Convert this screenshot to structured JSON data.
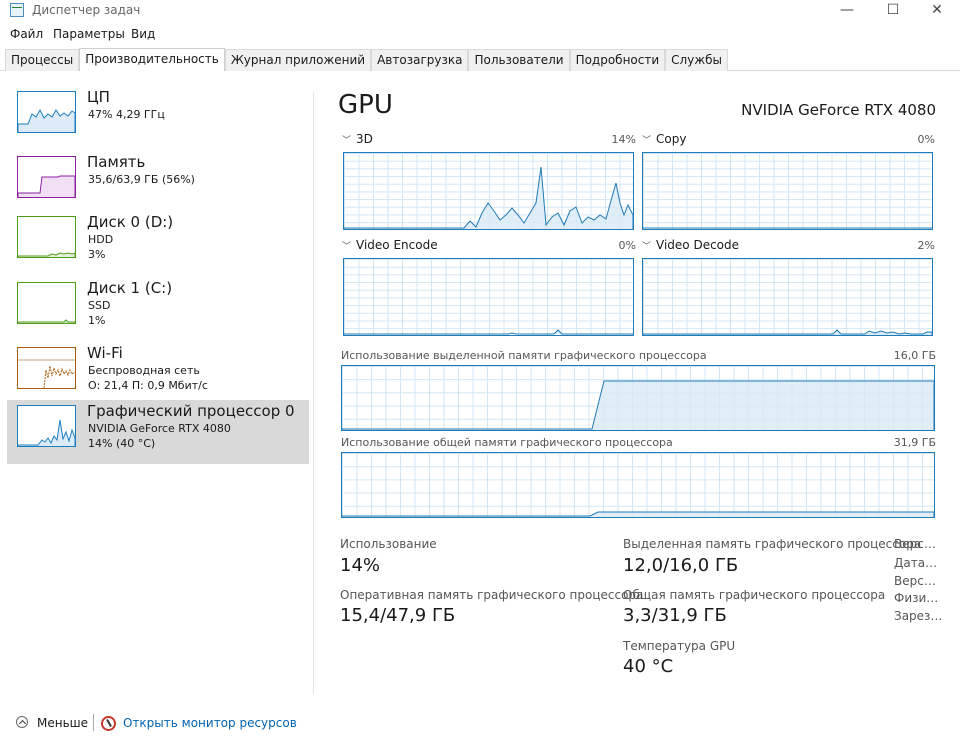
{
  "window": {
    "title": "Диспетчер задач",
    "controls": {
      "minimize": "—",
      "maximize": "☐",
      "close": "✕"
    }
  },
  "menu": [
    "Файл",
    "Параметры",
    "Вид"
  ],
  "tabs": [
    "Процессы",
    "Производительность",
    "Журнал приложений",
    "Автозагрузка",
    "Пользователи",
    "Подробности",
    "Службы"
  ],
  "active_tab": "Производительность",
  "sidebar": {
    "items": [
      {
        "name": "ЦП",
        "line1": "47% 4,29 ГГц",
        "line2": "",
        "color": "#1b7fbf",
        "usage_percent": 47
      },
      {
        "name": "Память",
        "line1": "35,6/63,9 ГБ (56%)",
        "line2": "",
        "color": "#8b1fa0",
        "usage_percent": 56
      },
      {
        "name": "Диск 0 (D:)",
        "line1": "HDD",
        "line2": "3%",
        "color": "#4d9e16",
        "usage_percent": 3
      },
      {
        "name": "Диск 1 (C:)",
        "line1": "SSD",
        "line2": "1%",
        "color": "#4d9e16",
        "usage_percent": 1
      },
      {
        "name": "Wi-Fi",
        "line1": "Беспроводная сеть",
        "line2": "О: 21,4 П: 0,9 Мбит/с",
        "color": "#a75f0f",
        "usage_percent": null
      },
      {
        "name": "Графический процессор 0",
        "line1": "NVIDIA GeForce RTX 4080",
        "line2": "14% (40 °C)",
        "color": "#1b7fbf",
        "usage_percent": 14
      }
    ]
  },
  "main": {
    "title": "GPU",
    "model": "NVIDIA GeForce RTX 4080",
    "engines": [
      {
        "label": "3D",
        "percent": "14%"
      },
      {
        "label": "Copy",
        "percent": "0%"
      },
      {
        "label": "Video Encode",
        "percent": "0%"
      },
      {
        "label": "Video Decode",
        "percent": "2%"
      }
    ],
    "dedicated_memory": {
      "label": "Использование выделенной памяти графического процессора",
      "max": "16,0 ГБ"
    },
    "shared_memory": {
      "label": "Использование общей памяти графического процессора",
      "max": "31,9 ГБ"
    },
    "stats": {
      "usage_label": "Использование",
      "usage_value": "14%",
      "dedicated_label": "Выделенная память графического процессора",
      "dedicated_value": "12,0/16,0 ГБ",
      "total_label": "Оперативная память графического процессора",
      "total_value": "15,4/47,9 ГБ",
      "shared_label": "Общая память графического процессора",
      "shared_value": "3,3/31,9 ГБ",
      "temp_label": "Температура GPU",
      "temp_value": "40 °C"
    },
    "side_stats": [
      "Верс…",
      "Дата…",
      "Верс…",
      "Физи…",
      "Зарез…"
    ]
  },
  "footer": {
    "less": "Меньше",
    "resource_monitor": "Открыть монитор ресурсов"
  },
  "colors": {
    "accent": "#1f7bb8",
    "link": "#0063b1",
    "selected_bg": "#d9d9d9"
  }
}
